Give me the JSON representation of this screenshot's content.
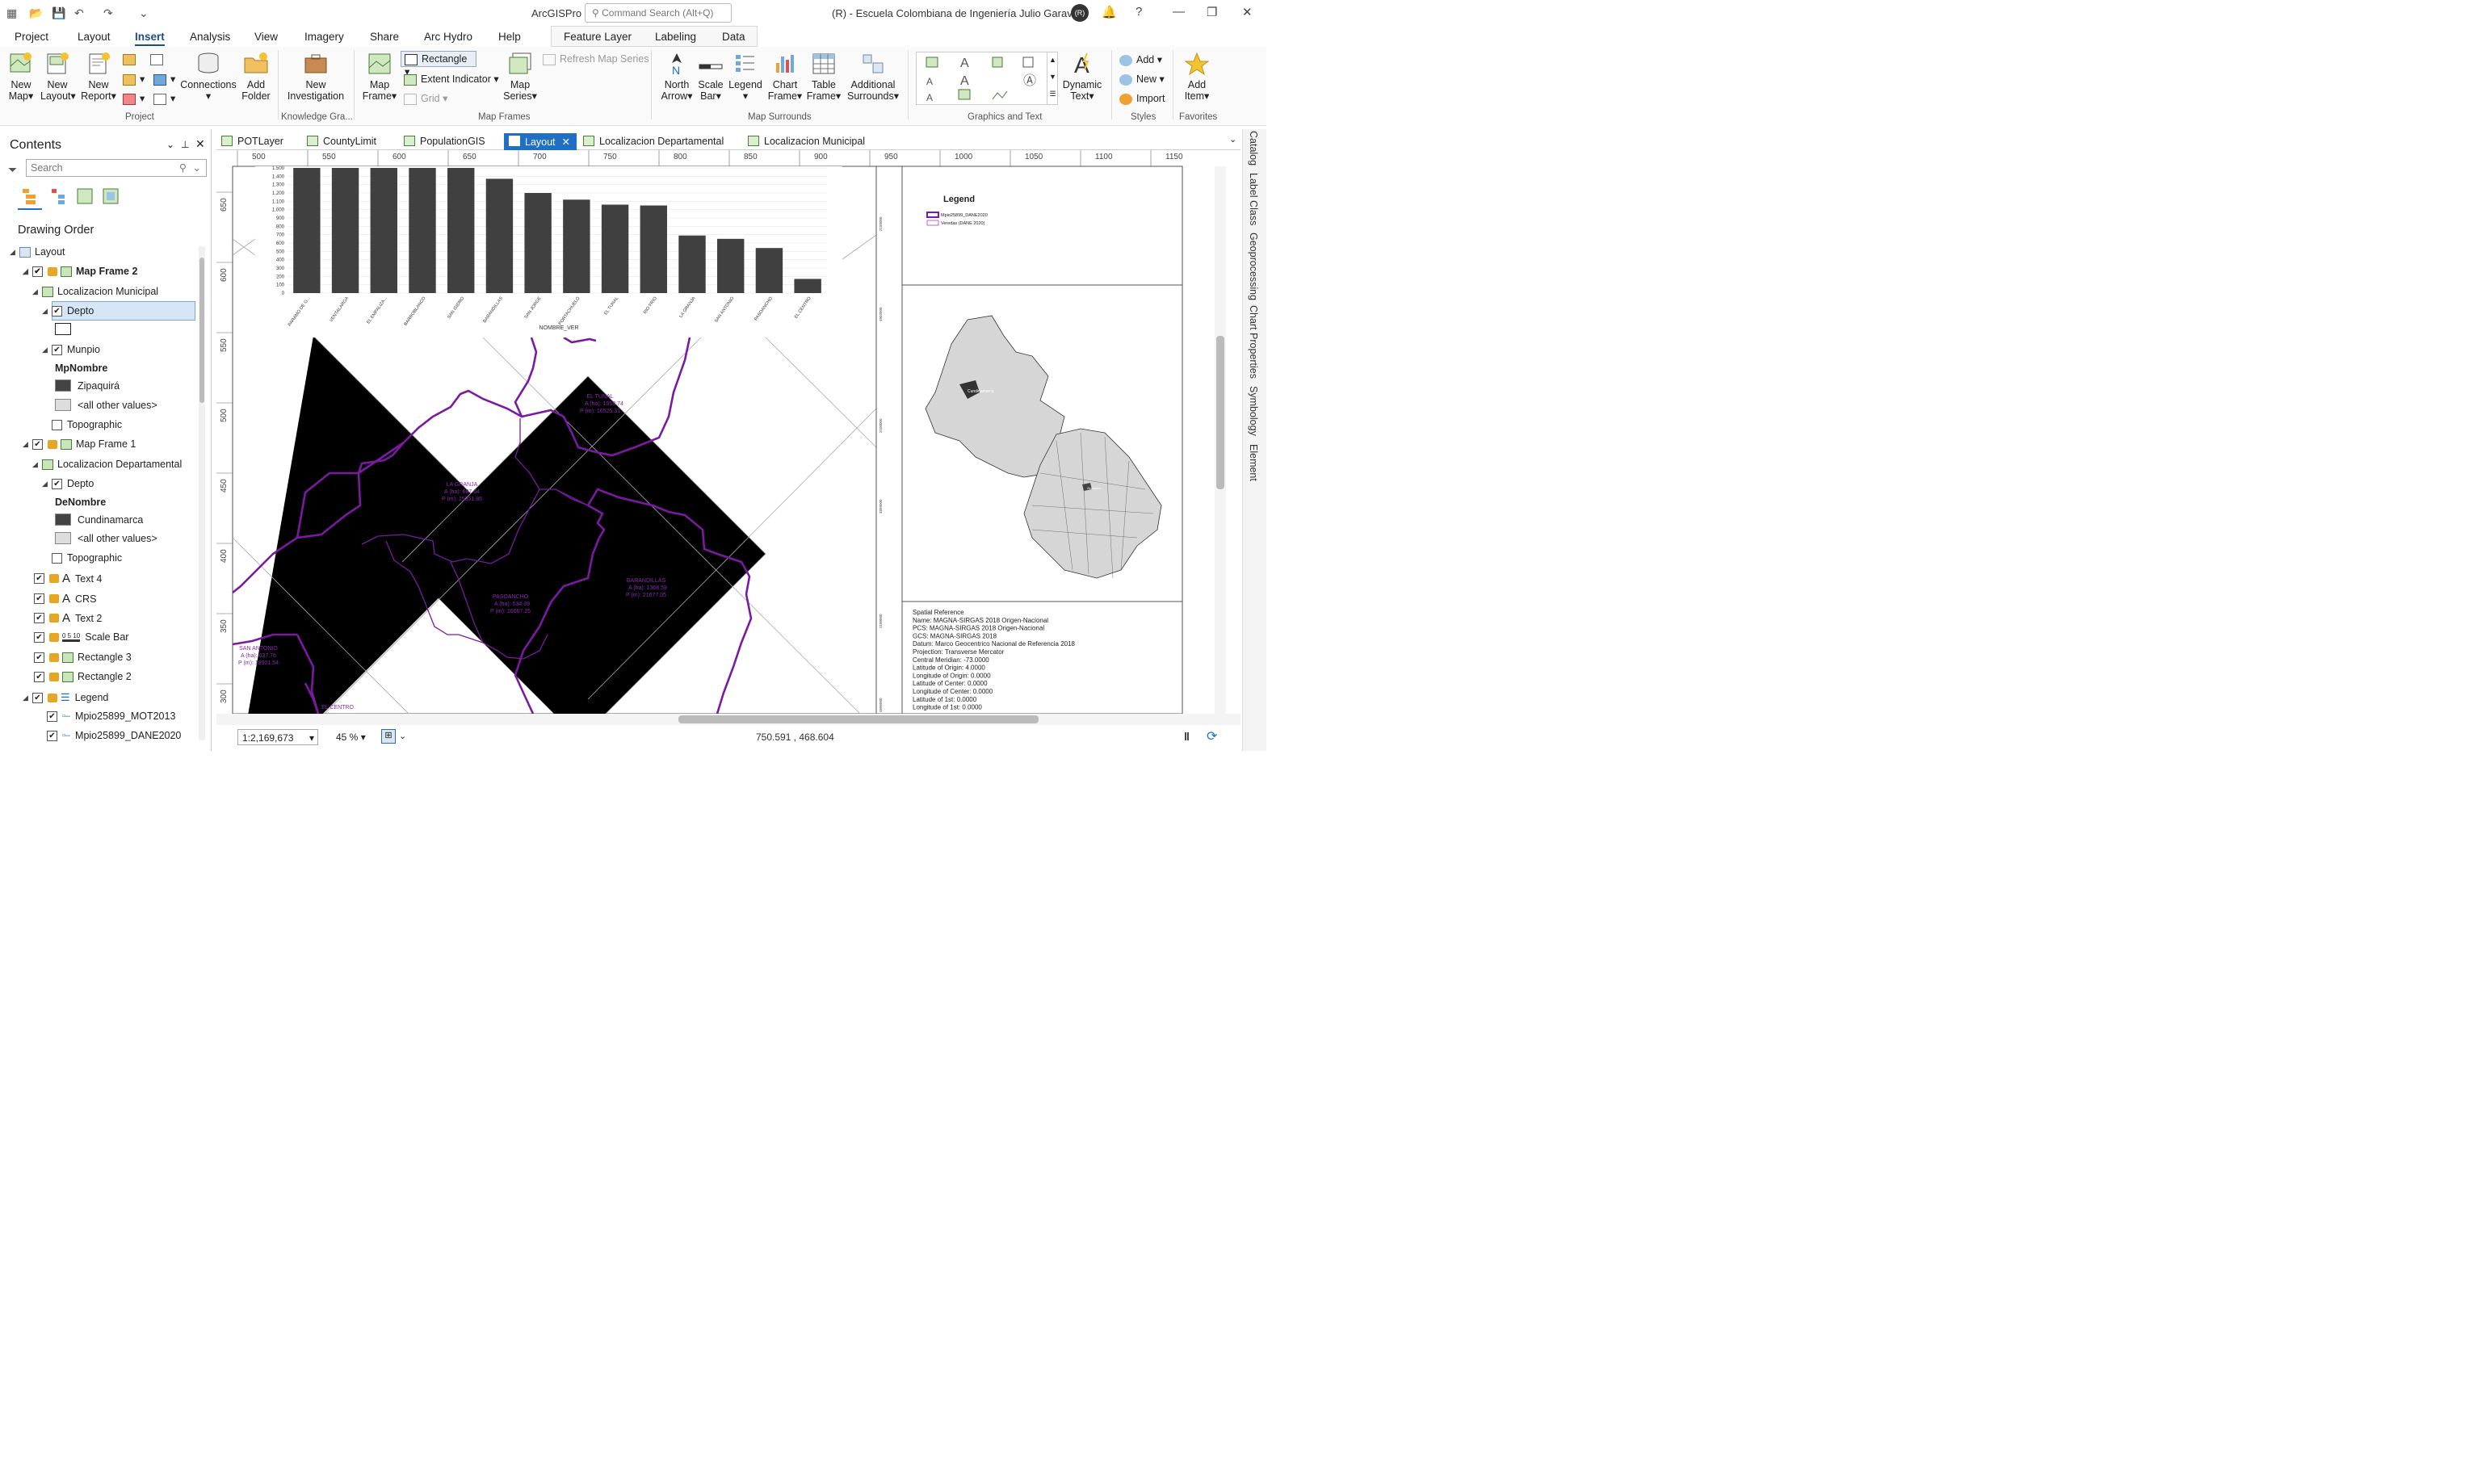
{
  "app": {
    "title": "ArcGISPro",
    "org": "(R) - Escuela Colombiana de Ingeniería Julio Garavito",
    "avatar": "(R)",
    "search_placeholder": "Command Search (Alt+Q)"
  },
  "menu": [
    "Project",
    "Layout",
    "Insert",
    "Analysis",
    "View",
    "Imagery",
    "Share",
    "Arc Hydro",
    "Help"
  ],
  "menu_active": "Insert",
  "context_tabs": [
    "Feature Layer",
    "Labeling",
    "Data"
  ],
  "ribbon": {
    "new_map": [
      "New",
      "Map"
    ],
    "new_layout": [
      "New",
      "Layout"
    ],
    "new_report": [
      "New",
      "Report"
    ],
    "connections": "Connections",
    "add_folder": [
      "Add",
      "Folder"
    ],
    "new_investigation": [
      "New",
      "Investigation"
    ],
    "map_frame": [
      "Map",
      "Frame"
    ],
    "rectangle": "Rectangle",
    "extent_indicator": "Extent Indicator",
    "grid": "Grid",
    "map_series": [
      "Map",
      "Series"
    ],
    "refresh_map_series": "Refresh Map Series",
    "north_arrow": [
      "North",
      "Arrow"
    ],
    "scale_bar": [
      "Scale",
      "Bar"
    ],
    "scale_bar_ticks": "0 5 10",
    "legend": "Legend",
    "chart_frame": [
      "Chart",
      "Frame"
    ],
    "table_frame": [
      "Table",
      "Frame"
    ],
    "additional_surrounds": [
      "Additional",
      "Surrounds"
    ],
    "dynamic_text": [
      "Dynamic",
      "Text"
    ],
    "add": "Add",
    "new": "New",
    "import": "Import",
    "add_item": [
      "Add",
      "Item"
    ],
    "groups": [
      "Project",
      "Knowledge Gra...",
      "Map Frames",
      "Map Surrounds",
      "Graphics and Text",
      "Styles",
      "Favorites"
    ]
  },
  "contents": {
    "title": "Contents",
    "search_placeholder": "Search",
    "drawing_order": "Drawing Order",
    "items": [
      "Layout",
      "Map Frame 2",
      "Localizacion Municipal",
      "Depto",
      "Munpio",
      "MpNombre",
      "Zipaquirá",
      "<all other values>",
      "Topographic",
      "Map Frame 1",
      "Localizacion Departamental",
      "Depto",
      "DeNombre",
      "Cundinamarca",
      "<all other values>",
      "Topographic",
      "Text 4",
      "CRS",
      "Text 2",
      "Scale Bar",
      "Rectangle 3",
      "Rectangle 2",
      "Legend",
      "Mpio25899_MOT2013",
      "Mpio25899_DANE2020"
    ]
  },
  "tabs": [
    "POTLayer",
    "CountyLimit",
    "PopulationGIS",
    "Layout",
    "Localizacion Departamental",
    "Localizacion Municipal"
  ],
  "active_tab": "Layout",
  "ruler_top": [
    "500",
    "550",
    "600",
    "650",
    "700",
    "750",
    "800",
    "850",
    "900",
    "950",
    "1000",
    "1050",
    "1100",
    "1150"
  ],
  "ruler_left": [
    "650",
    "600",
    "550",
    "500",
    "450",
    "400",
    "350",
    "300"
  ],
  "right_rail": [
    "Catalog",
    "Label Class",
    "Geoprocessing",
    "Chart Properties",
    "Symbology",
    "Element"
  ],
  "status": {
    "scale": "1:2,169,673",
    "zoom": "45 %",
    "coords": "750.591 , 468.604"
  },
  "chart_data": {
    "type": "bar",
    "xlabel": "NOMBRE_VER",
    "ylabel": "",
    "ylim": [
      0,
      1500
    ],
    "yticks": [
      "1.500",
      "1.400",
      "1.300",
      "1.200",
      "1.100",
      "1.000",
      "900",
      "800",
      "700",
      "600",
      "500",
      "400",
      "300",
      "200",
      "100",
      "0"
    ],
    "categories": [
      "PARAMO DE G...",
      "VENTALARGA",
      "EL EMPALIZA...",
      "BARROBLANCO",
      "SAN ISIDRO",
      "BARANDILLAS",
      "SAN JORGE",
      "PORTACHUELO",
      "EL TUNAL",
      "RIO FRIO",
      "LA GRANJA",
      "SAN ANTONIO",
      "PASOANCHO",
      "EL CENTRO"
    ],
    "values": [
      1500,
      1500,
      1500,
      1500,
      1500,
      1370,
      1200,
      1120,
      1060,
      1050,
      690,
      650,
      540,
      170
    ],
    "color": "#404040"
  },
  "map_labels": [
    {
      "name": "EL TUNAL",
      "area": "A (ha): 1059.74",
      "per": "P (m): 16525.31"
    },
    {
      "name": "LA GRANJA",
      "area": "A (ha): 687.64",
      "per": "P (m): 15301.86"
    },
    {
      "name": "BARANDILLAS",
      "area": "A (ha): 1368.59",
      "per": "P (m): 21677.05"
    },
    {
      "name": "PASOANCHO",
      "area": "A (ha): 534.39",
      "per": "P (m): 16667.25"
    },
    {
      "name": "SAN ANTONIO",
      "area": "A (ha): 637.76",
      "per": "P (m): 18901.54"
    },
    {
      "name": "EL CENTRO",
      "area": "",
      "per": ""
    }
  ],
  "legend": {
    "title": "Legend",
    "items": [
      "Mpio25899_DANE2020",
      "Veredas (DANE 2020)"
    ]
  },
  "map_inset_labels": [
    "Cundinamarca",
    "Zipaquirá"
  ],
  "spatial_reference": [
    "Spatial Reference",
    "Name: MAGNA-SIRGAS 2018 Origen-Nacional",
    "PCS: MAGNA-SIRGAS 2018 Origen-Nacional",
    "GCS: MAGNA-SIRGAS 2018",
    "Datum: Marco Geocentrico Nacional de Referencia 2018",
    "Projection: Transverse Mercator",
    "Central Meridian: -73.0000",
    "Latitude of Origin: 4.0000",
    "Longitude of Origin: 0.0000",
    "Latitude of Center: 0.0000",
    "Longitude of Center: 0.0000",
    "Latitude of 1st: 0.0000",
    "Longitude of 1st: 0.0000"
  ],
  "grid_labels": [
    "2150000",
    "4902000",
    "2100000",
    "4899000",
    "2100000",
    "4896000"
  ],
  "colors": {
    "accent": "#1f6fc5",
    "boundary": "#7a1aa0",
    "bars": "#404040"
  }
}
